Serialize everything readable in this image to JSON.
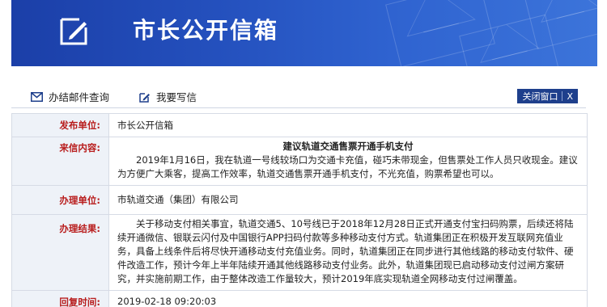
{
  "banner": {
    "title": "市长公开信箱"
  },
  "toolbar": {
    "query_label": "办结邮件查询",
    "write_label": "我要写信",
    "close_label": "关闭窗口",
    "close_x": "X"
  },
  "rows": {
    "publisher": {
      "label": "发布单位:",
      "value": "市长公开信箱"
    },
    "letter": {
      "label": "来信内容:",
      "subject": "建议轨道交通售票开通手机支付",
      "body": "2019年1月16日，我在轨道一号线较场口为交通卡充值，碰巧未带现金，但售票处工作人员只收现金。建议为方便广大乘客，提高工作效率，轨道交通售票开通手机支付，不光充值，购票希望也可以。"
    },
    "handler": {
      "label": "办理单位:",
      "value": "市轨道交通（集团）有限公司"
    },
    "result": {
      "label": "办理结果:",
      "body": "关于移动支付相关事宜，轨道交通5、10号线已于2018年12月28日正式开通支付宝扫码购票，后续还将陆续开通微信、银联云闪付及中国银行APP扫码付款等多种移动支付方式。轨道集团正在积极开发互联网充值业务，具备上线条件后将尽快开通移动支付充值业务。同时，轨道集团正在同步进行其他线路的移动支付软件、硬件改造工作，预计今年上半年陆续开通其他线路移动支付业务。此外，轨道集团现已启动移动支付过闸方案研究，并实施前期工作，由于整体改造工作量较大，预计2019年底实现轨道全网移动支付过闸覆盖。"
    },
    "reply_time": {
      "label": "回复时间:",
      "value": "2019-02-18 09:20:03"
    }
  },
  "colors": {
    "banner": "#2450bd",
    "label_text": "#b81c1c",
    "label_bg": "#eef2f8",
    "close_button": "#1e3f8c"
  }
}
